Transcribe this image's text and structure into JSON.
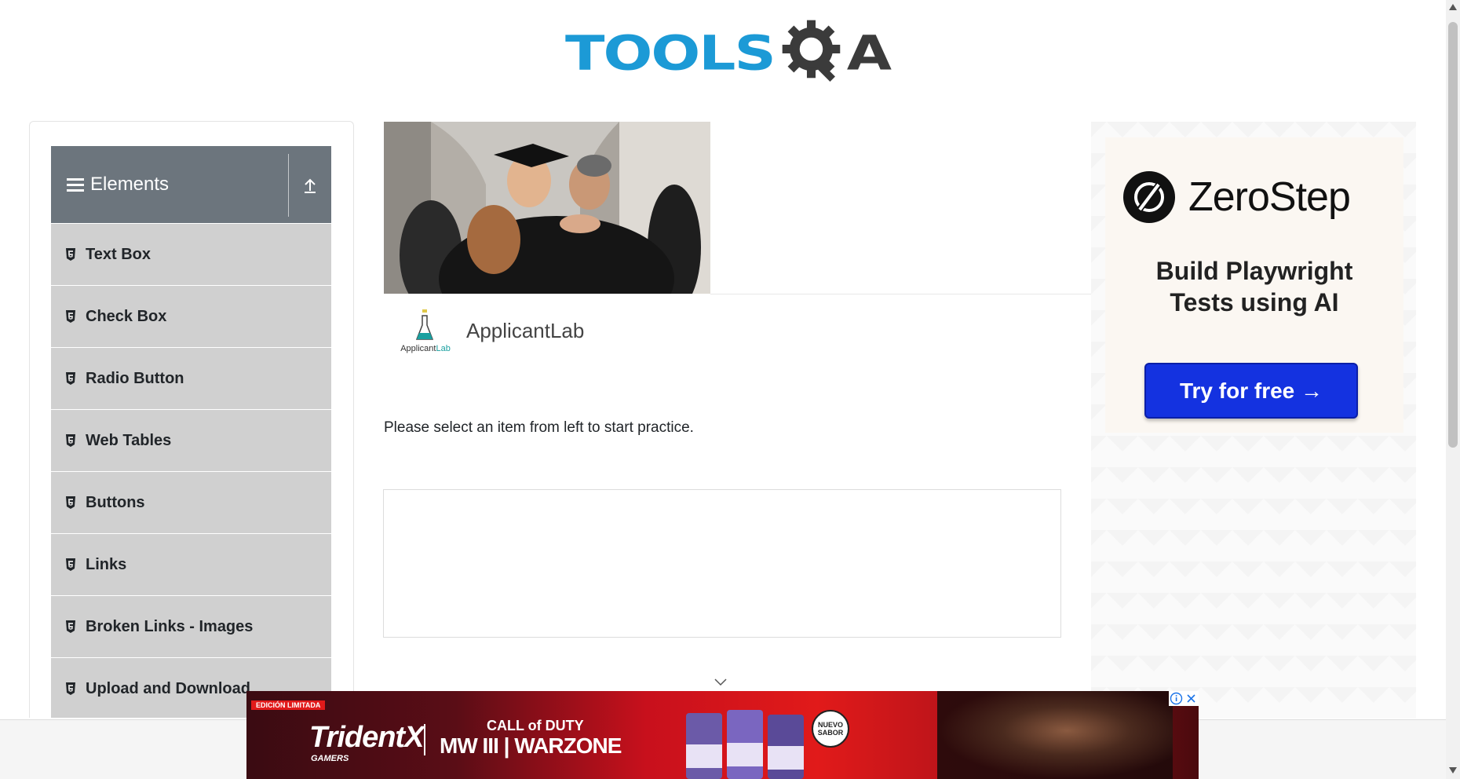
{
  "header": {
    "logo_text_left": "TOOLS",
    "logo_text_right": "A"
  },
  "sidebar": {
    "group_title": "Elements",
    "items": [
      {
        "label": "Text Box"
      },
      {
        "label": "Check Box"
      },
      {
        "label": "Radio Button"
      },
      {
        "label": "Web Tables"
      },
      {
        "label": "Buttons"
      },
      {
        "label": "Links"
      },
      {
        "label": "Broken Links - Images"
      },
      {
        "label": "Upload and Download"
      }
    ]
  },
  "main": {
    "sponsor_logo_caption_a": "Applicant",
    "sponsor_logo_caption_b": "Lab",
    "sponsor_name": "ApplicantLab",
    "instruction": "Please select an item from left to start practice."
  },
  "right_ad": {
    "brand": "ZeroStep",
    "headline_line1": "Build Playwright",
    "headline_line2": "Tests using AI",
    "cta": "Try for free →"
  },
  "bottom_ad": {
    "tag": "EDICIÓN LIMITADA",
    "brand": "TridentX",
    "brand_sub": "GAMERS",
    "game_top": "CALL of DUTY",
    "game": "MW III | WARZONE",
    "badge": "NUEVO SABOR"
  },
  "colors": {
    "brand_blue": "#1c9ad6",
    "sidebar_header": "#6c757d",
    "sidebar_item": "#d0d0d0",
    "cta_blue": "#1432e0"
  }
}
